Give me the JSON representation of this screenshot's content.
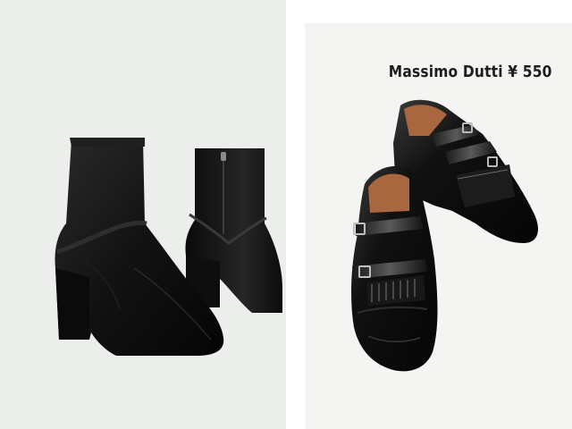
{
  "caption": {
    "text": "Massimo Dutti ¥ 550"
  },
  "colors": {
    "left_background": "#eceeeb",
    "right_background": "#f4f4f3",
    "velvet": "#141414",
    "leather": "#0d0d0d",
    "lining": "#a8673f"
  },
  "photos": [
    {
      "subject": "black velvet block-heel ankle boots"
    },
    {
      "subject": "black leather double monk-strap shoes with fringe"
    }
  ]
}
